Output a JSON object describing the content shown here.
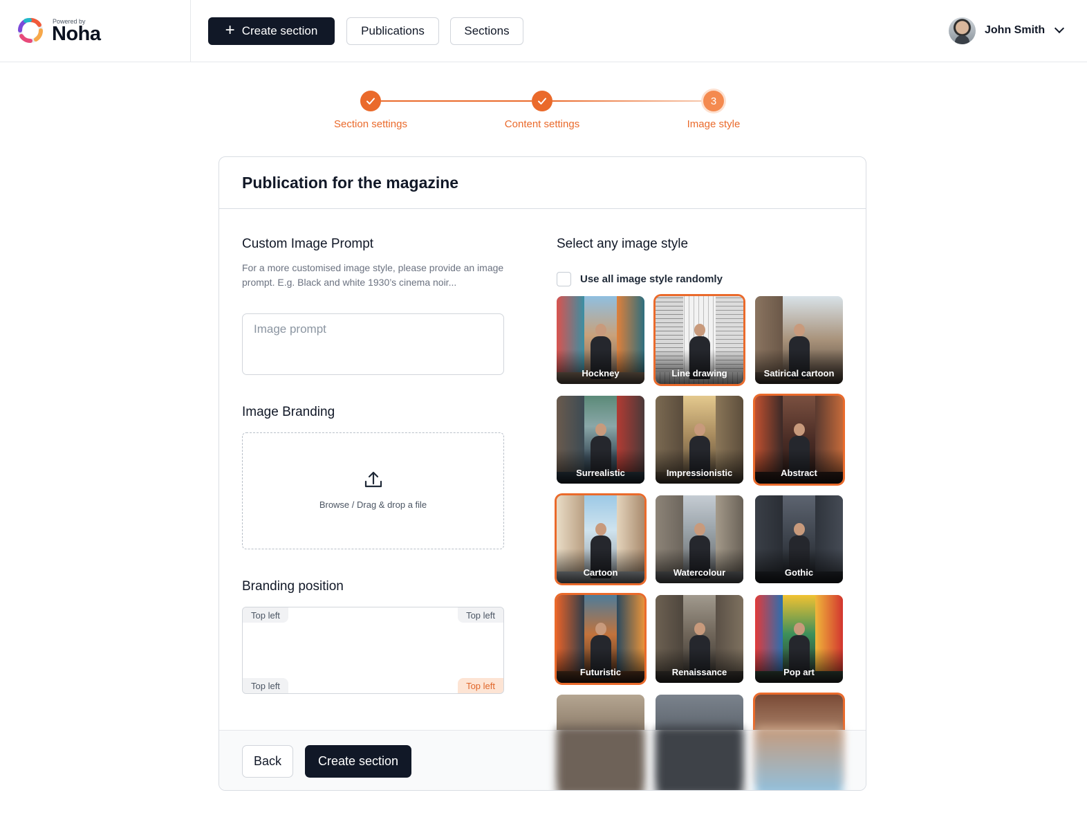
{
  "brand": {
    "powered_by": "Powered by",
    "name": "Noha"
  },
  "nav": {
    "create_label": "Create section",
    "publications_label": "Publications",
    "sections_label": "Sections"
  },
  "user": {
    "name": "John Smith"
  },
  "stepper": {
    "steps": [
      {
        "label": "Section settings",
        "state": "done"
      },
      {
        "label": "Content settings",
        "state": "done"
      },
      {
        "label": "Image style",
        "state": "current",
        "number": "3"
      }
    ]
  },
  "card": {
    "title": "Publication for the magazine",
    "custom_prompt": {
      "heading": "Custom Image Prompt",
      "help": "For a more customised image style, please provide an image prompt. E.g. Black and white 1930’s cinema noir...",
      "placeholder": "Image prompt",
      "value": ""
    },
    "branding": {
      "heading": "Image Branding",
      "drop_text": "Browse / Drag & drop a file"
    },
    "position": {
      "heading": "Branding position",
      "top_left": "Top left",
      "top_right": "Top left",
      "bottom_left": "Top left",
      "bottom_right": "Top left",
      "selected": "bottom_right"
    },
    "styles": {
      "heading": "Select any image style",
      "random_label": "Use all image style randomly",
      "random_checked": false,
      "items": [
        {
          "label": "Hockney",
          "selected": false
        },
        {
          "label": "Line drawing",
          "selected": true
        },
        {
          "label": "Satirical cartoon",
          "selected": false
        },
        {
          "label": "Surrealistic",
          "selected": false
        },
        {
          "label": "Impressionistic",
          "selected": false
        },
        {
          "label": "Abstract",
          "selected": true
        },
        {
          "label": "Cartoon",
          "selected": true
        },
        {
          "label": "Watercolour",
          "selected": false
        },
        {
          "label": "Gothic",
          "selected": false
        },
        {
          "label": "Futuristic",
          "selected": true
        },
        {
          "label": "Renaissance",
          "selected": false
        },
        {
          "label": "Pop art",
          "selected": false
        }
      ]
    },
    "footer": {
      "back_label": "Back",
      "create_label": "Create section"
    }
  },
  "colors": {
    "accent": "#ea6a2b",
    "dark": "#111827",
    "accent_light": "#fde4d4"
  }
}
